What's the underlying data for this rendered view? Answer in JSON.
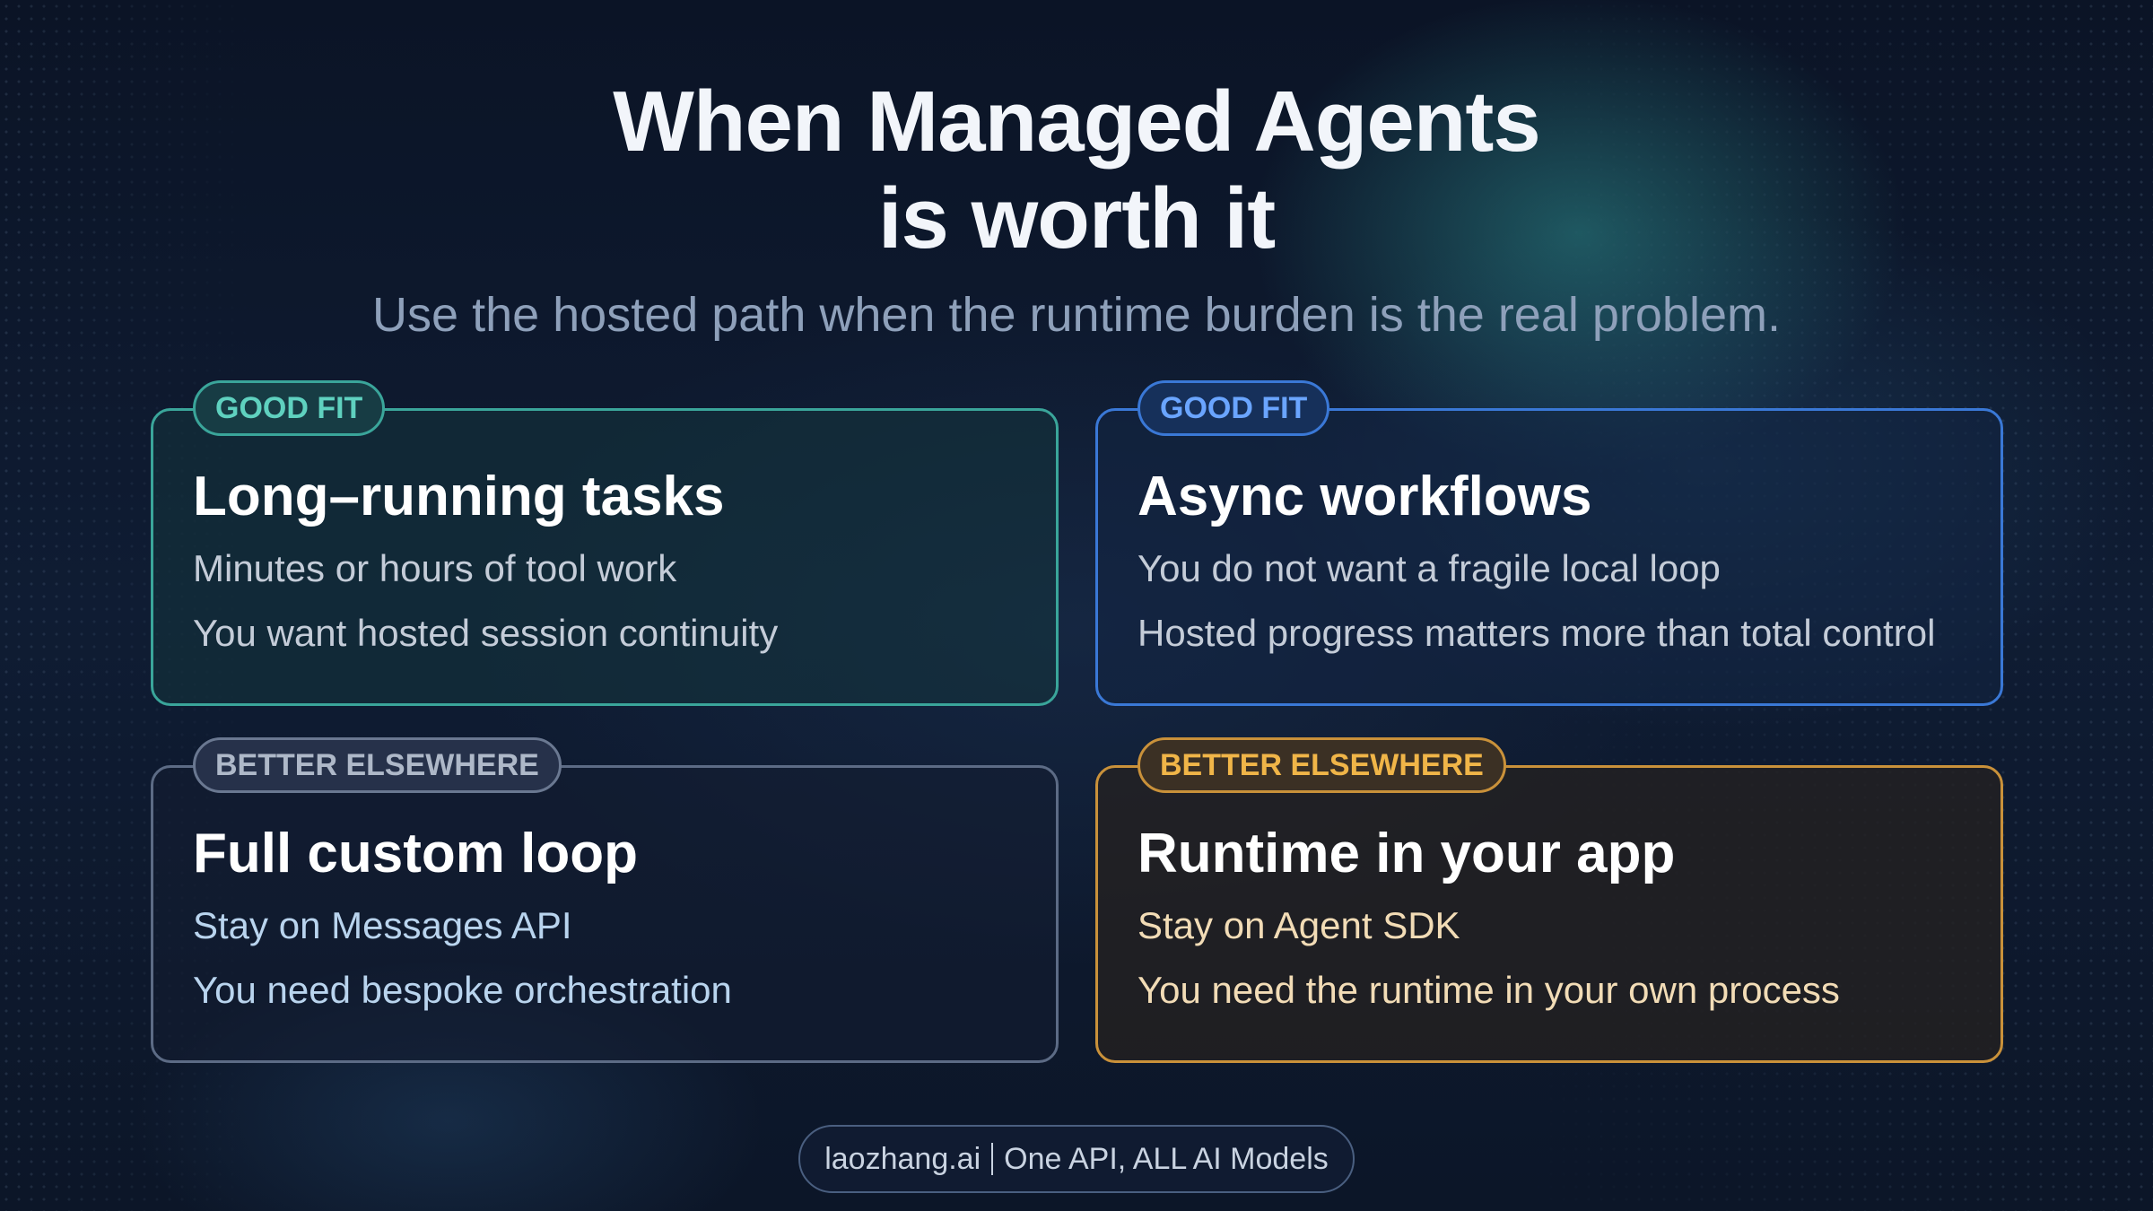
{
  "title_line1": "When Managed Agents",
  "title_line2": "is worth it",
  "subtitle": "Use the hosted path when the runtime burden is the real problem.",
  "cards": [
    {
      "badge": "GOOD FIT",
      "title": "Long–running tasks",
      "lines": [
        "Minutes or hours of tool work",
        "You want hosted session continuity"
      ]
    },
    {
      "badge": "GOOD FIT",
      "title": "Async workflows",
      "lines": [
        "You do not want a fragile local loop",
        "Hosted progress matters more than total control"
      ]
    },
    {
      "badge": "BETTER ELSEWHERE",
      "title": "Full custom loop",
      "lines": [
        "Stay on Messages API",
        "You need bespoke orchestration"
      ]
    },
    {
      "badge": "BETTER ELSEWHERE",
      "title": "Runtime in your app",
      "lines": [
        "Stay on Agent SDK",
        "You need the runtime in your own process"
      ]
    }
  ],
  "footer": {
    "brand": "laozhang.ai",
    "tagline": "One API, ALL AI Models"
  },
  "colors": {
    "good_fit_teal": "#3aa59a",
    "good_fit_blue": "#3a78d6",
    "elsewhere_gray": "#5c6b85",
    "elsewhere_amber": "#c9913a"
  }
}
